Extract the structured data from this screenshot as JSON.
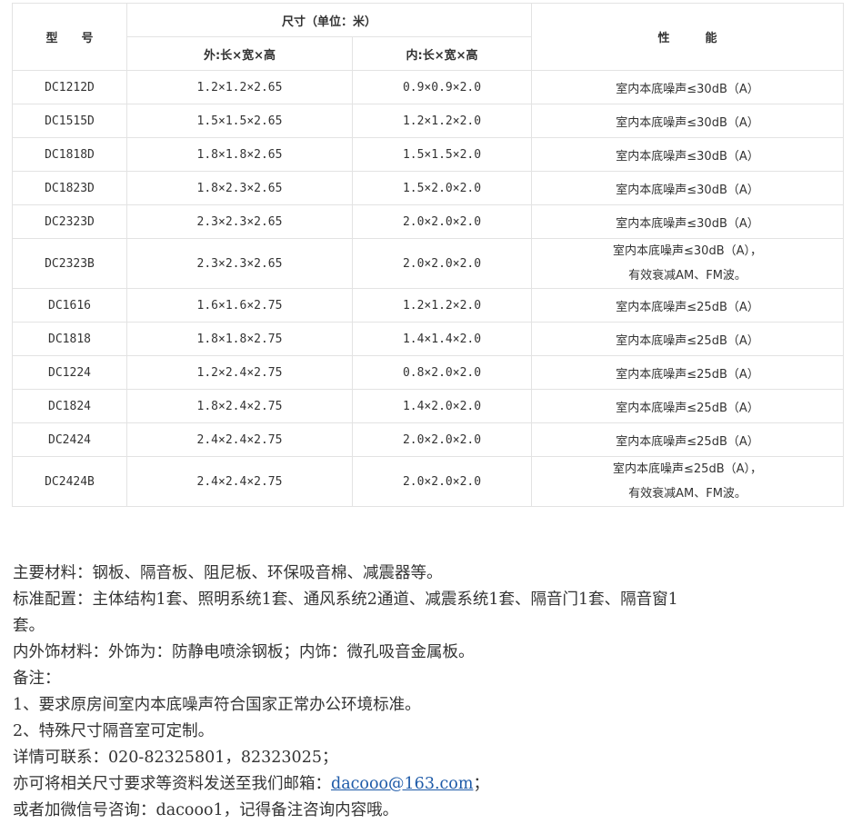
{
  "table": {
    "header": {
      "model": "型　　号",
      "size": "尺寸（单位：米）",
      "outer": "外:长×宽×高",
      "inner": "内:长×宽×高",
      "performance": "性　　　能"
    },
    "rows": [
      {
        "model": "DC1212D",
        "outer": "1.2×1.2×2.65",
        "inner": "0.9×0.9×2.0",
        "perf": [
          "室内本底噪声≤30dB（A）"
        ]
      },
      {
        "model": "DC1515D",
        "outer": "1.5×1.5×2.65",
        "inner": "1.2×1.2×2.0",
        "perf": [
          "室内本底噪声≤30dB（A）"
        ]
      },
      {
        "model": "DC1818D",
        "outer": "1.8×1.8×2.65",
        "inner": "1.5×1.5×2.0",
        "perf": [
          "室内本底噪声≤30dB（A）"
        ]
      },
      {
        "model": "DC1823D",
        "outer": "1.8×2.3×2.65",
        "inner": "1.5×2.0×2.0",
        "perf": [
          "室内本底噪声≤30dB（A）"
        ]
      },
      {
        "model": "DC2323D",
        "outer": "2.3×2.3×2.65",
        "inner": "2.0×2.0×2.0",
        "perf": [
          "室内本底噪声≤30dB（A）"
        ]
      },
      {
        "model": "DC2323B",
        "outer": "2.3×2.3×2.65",
        "inner": "2.0×2.0×2.0",
        "perf": [
          "室内本底噪声≤30dB（A），",
          "有效衰减AM、FM波。"
        ]
      },
      {
        "model": "DC1616",
        "outer": "1.6×1.6×2.75",
        "inner": "1.2×1.2×2.0",
        "perf": [
          "室内本底噪声≤25dB（A）"
        ]
      },
      {
        "model": "DC1818",
        "outer": "1.8×1.8×2.75",
        "inner": "1.4×1.4×2.0",
        "perf": [
          "室内本底噪声≤25dB（A）"
        ]
      },
      {
        "model": "DC1224",
        "outer": "1.2×2.4×2.75",
        "inner": "0.8×2.0×2.0",
        "perf": [
          "室内本底噪声≤25dB（A）"
        ]
      },
      {
        "model": "DC1824",
        "outer": "1.8×2.4×2.75",
        "inner": "1.4×2.0×2.0",
        "perf": [
          "室内本底噪声≤25dB（A）"
        ]
      },
      {
        "model": "DC2424",
        "outer": "2.4×2.4×2.75",
        "inner": "2.0×2.0×2.0",
        "perf": [
          "室内本底噪声≤25dB（A）"
        ]
      },
      {
        "model": "DC2424B",
        "outer": "2.4×2.4×2.75",
        "inner": "2.0×2.0×2.0",
        "perf": [
          "室内本底噪声≤25dB（A），",
          "有效衰减AM、FM波。"
        ]
      }
    ]
  },
  "notes": {
    "materials": "主要材料：钢板、隔音板、阻尼板、环保吸音棉、减震器等。",
    "config_line1": "标准配置：主体结构1套、照明系统1套、通风系统2通道、减震系统1套、隔音门1套、隔音窗1",
    "config_line2": "套。",
    "finish": "内外饰材料：外饰为：防静电喷涂钢板；内饰：微孔吸音金属板。",
    "remark_title": "备注：",
    "remark_1": "1、要求原房间室内本底噪声符合国家正常办公环境标准。",
    "remark_2": "2、特殊尺寸隔音室可定制。",
    "contact_phone": "详情可联系：020-82325801，82323025；",
    "email_prefix": "亦可将相关尺寸要求等资料发送至我们邮箱：",
    "email": "dacooo@163.com",
    "email_suffix": "；",
    "wechat": "或者加微信号咨询：dacooo1，记得备注咨询内容哦。"
  },
  "colors": {
    "text": "#333333",
    "border": "#e3e3e3",
    "link": "#1d5aa8"
  }
}
